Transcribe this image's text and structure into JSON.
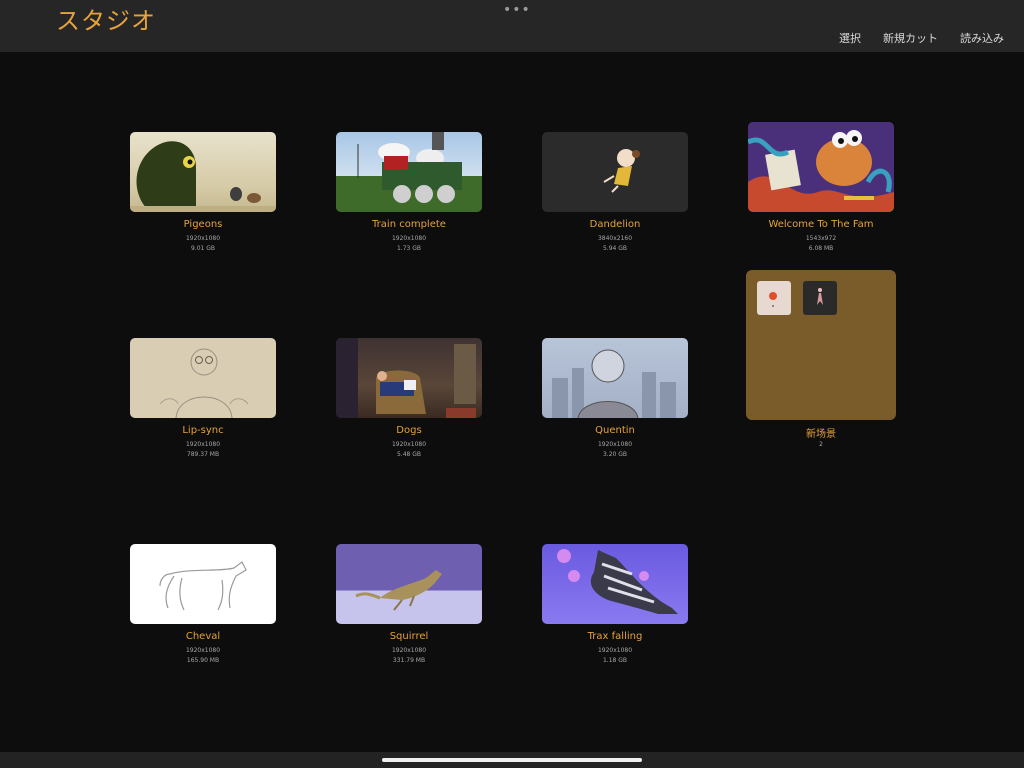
{
  "app": {
    "title": "スタジオ",
    "more": "•••"
  },
  "actions": {
    "select": "選択",
    "new_cut": "新規カット",
    "import": "読み込み"
  },
  "projects": [
    {
      "name": "Pigeons",
      "resolution": "1920x1080",
      "size": "9.01 GB"
    },
    {
      "name": "Train complete",
      "resolution": "1920x1080",
      "size": "1.73 GB"
    },
    {
      "name": "Dandelion",
      "resolution": "3840x2160",
      "size": "5.94 GB"
    },
    {
      "name": "Welcome To The Fam",
      "resolution": "1543x972",
      "size": "6.08 MB"
    },
    {
      "name": "Lip-sync",
      "resolution": "1920x1080",
      "size": "789.37 MB"
    },
    {
      "name": "Dogs",
      "resolution": "1920x1080",
      "size": "5.48 GB"
    },
    {
      "name": "Quentin",
      "resolution": "1920x1080",
      "size": "3.20 GB"
    },
    {
      "name": "Cheval",
      "resolution": "1920x1080",
      "size": "165.90 MB"
    },
    {
      "name": "Squirrel",
      "resolution": "1920x1080",
      "size": "331.79 MB"
    },
    {
      "name": "Trax falling",
      "resolution": "1920x1080",
      "size": "1.18 GB"
    }
  ],
  "folder": {
    "name": "新场景",
    "count": "2"
  },
  "colors": {
    "accent": "#e6a23c",
    "background": "#0d0d0d",
    "topbar": "#262626",
    "folder": "#7a5c2a"
  }
}
